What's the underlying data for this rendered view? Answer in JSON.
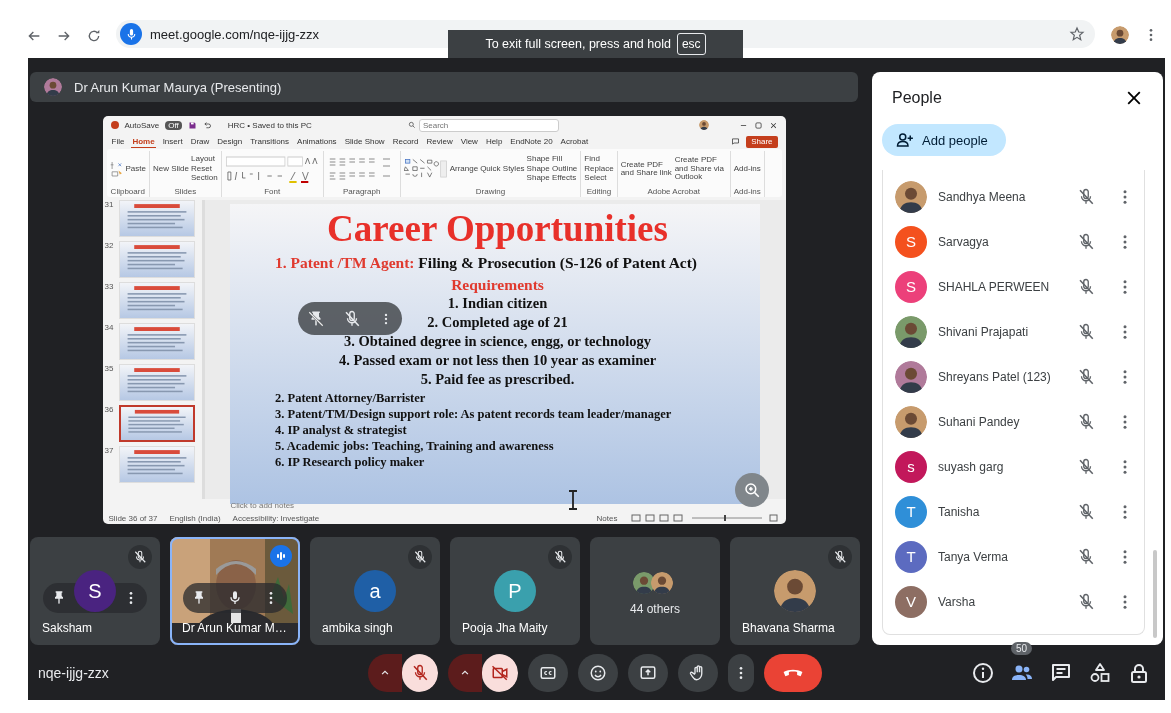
{
  "browser": {
    "url": "meet.google.com/nqe-ijjg-zzx",
    "notice": "To exit full screen, press and hold",
    "notice_key": "esc"
  },
  "presenter_bar": {
    "label": "Dr Arun Kumar Maurya (Presenting)"
  },
  "powerpoint": {
    "autosave_label": "AutoSave",
    "autosave_state": "Off",
    "file_title": "HRC • Saved to this PC",
    "search_placeholder": "Search",
    "share": "Share",
    "tabs": [
      {
        "label": "File",
        "selected": false
      },
      {
        "label": "Home",
        "selected": true
      },
      {
        "label": "Insert",
        "selected": false
      },
      {
        "label": "Draw",
        "selected": false
      },
      {
        "label": "Design",
        "selected": false
      },
      {
        "label": "Transitions",
        "selected": false
      },
      {
        "label": "Animations",
        "selected": false
      },
      {
        "label": "Slide Show",
        "selected": false
      },
      {
        "label": "Record",
        "selected": false
      },
      {
        "label": "Review",
        "selected": false
      },
      {
        "label": "View",
        "selected": false
      },
      {
        "label": "Help",
        "selected": false
      },
      {
        "label": "EndNote 20",
        "selected": false
      },
      {
        "label": "Acrobat",
        "selected": false
      }
    ],
    "ribbon_groups": [
      {
        "label": "Clipboard",
        "kind": "clipboard",
        "buttons": [
          "Paste"
        ]
      },
      {
        "label": "Slides",
        "kind": "plain",
        "buttons": [
          "New Slide",
          "Layout",
          "Reset",
          "Section"
        ]
      },
      {
        "label": "Font",
        "kind": "font"
      },
      {
        "label": "Paragraph",
        "kind": "paragraph"
      },
      {
        "label": "Drawing",
        "kind": "shapes",
        "buttons": [
          "Arrange",
          "Quick Styles",
          "Shape Fill",
          "Shape Outline",
          "Shape Effects"
        ]
      },
      {
        "label": "Editing",
        "kind": "plain",
        "buttons": [
          "Find",
          "Replace",
          "Select"
        ]
      },
      {
        "label": "Adobe Acrobat",
        "kind": "plain",
        "buttons": [
          "Create PDF and Share link",
          "Create PDF and Share via Outlook"
        ]
      },
      {
        "label": "Add-ins",
        "kind": "plain",
        "buttons": [
          "Add-ins"
        ]
      }
    ],
    "thumbnails": [
      {
        "number": "31",
        "selected": false
      },
      {
        "number": "32",
        "selected": false
      },
      {
        "number": "33",
        "selected": false
      },
      {
        "number": "34",
        "selected": false
      },
      {
        "number": "35",
        "selected": false
      },
      {
        "number": "36",
        "selected": true
      },
      {
        "number": "37",
        "selected": false
      }
    ],
    "slide": {
      "title": "Career Opportunities",
      "lead_label": "1. Patent /TM Agent:",
      "lead_text": "Filing & Prosecution  (S-126 of Patent Act)",
      "requirements_title": "Requirements",
      "requirements": [
        "1. Indian citizen",
        "2. Completed age of 21",
        "3. Obtained degree in science, engg, or technology",
        "4. Passed exam or not less then 10 year as examiner",
        "5. Paid fee as prescribed."
      ],
      "roles": [
        "2. Patent Attorney/Barrister",
        "3. Patent/TM/Design support role: As patent records team leader/manager",
        "4. IP analyst & strategist",
        "5. Academic jobs: Teaching, Training and awareness",
        "6. IP Research policy maker"
      ]
    },
    "notes_placeholder": "Click to add notes",
    "status_items": [
      "Slide 36 of 37",
      "English (India)",
      "Accessibility: Investigate"
    ],
    "notes_button": "Notes"
  },
  "tiles": [
    {
      "name": "Saksham",
      "kind": "letter",
      "letter": "S",
      "color": "#4a2380",
      "muted": true,
      "speaking": false,
      "hovered": true
    },
    {
      "name": "Dr Arun Kumar M…",
      "kind": "video",
      "muted": false,
      "speaking": true,
      "hovered": true
    },
    {
      "name": "ambika singh",
      "kind": "letter",
      "letter": "a",
      "color": "#1f5fa6",
      "muted": true,
      "speaking": false,
      "hovered": false
    },
    {
      "name": "Pooja Jha Maity",
      "kind": "letter",
      "letter": "P",
      "color": "#3aa0ad",
      "muted": true,
      "speaking": false,
      "hovered": false
    },
    {
      "name": "44 others",
      "kind": "group",
      "muted": false,
      "speaking": false,
      "hovered": false
    },
    {
      "name": "Bhavana Sharma",
      "muted": true,
      "speaking": false,
      "hovered": false
    }
  ],
  "meeting_code": "nqe-ijjg-zzx",
  "controls": [
    {
      "kind": "mic",
      "on": false
    },
    {
      "kind": "camera",
      "on": false
    },
    {
      "kind": "captions"
    },
    {
      "kind": "reactions"
    },
    {
      "kind": "present"
    },
    {
      "kind": "raise-hand"
    },
    {
      "kind": "more"
    },
    {
      "kind": "leave"
    }
  ],
  "side_controls": [
    {
      "kind": "info",
      "selected": false
    },
    {
      "kind": "people",
      "selected": true,
      "badge": "50"
    },
    {
      "kind": "chat",
      "selected": false
    },
    {
      "kind": "activities",
      "selected": false
    },
    {
      "kind": "host-controls",
      "selected": false
    }
  ],
  "people_panel": {
    "title": "People",
    "add_button": "Add people",
    "people": [
      {
        "name": "Sandhya Meena",
        "muted": true
      },
      {
        "name": "Sarvagya",
        "kind": "letter",
        "letter": "S",
        "color": "#f4511e",
        "muted": true
      },
      {
        "name": "SHAHLA PERWEEN",
        "kind": "letter",
        "letter": "S",
        "color": "#ec407a",
        "muted": true
      },
      {
        "name": "Shivani Prajapati",
        "muted": true
      },
      {
        "name": "Shreyans Patel (123)",
        "muted": true
      },
      {
        "name": "Suhani Pandey",
        "muted": true
      },
      {
        "name": "suyash garg",
        "kind": "letter",
        "letter": "s",
        "color": "#c2185b",
        "muted": true
      },
      {
        "name": "Tanisha",
        "kind": "letter",
        "letter": "T",
        "color": "#2f8fd8",
        "muted": true
      },
      {
        "name": "Tanya Verma",
        "kind": "letter",
        "letter": "T",
        "color": "#5c6bc0",
        "muted": true
      },
      {
        "name": "Varsha",
        "kind": "letter",
        "letter": "V",
        "color": "#8d6e63",
        "muted": true
      }
    ]
  }
}
